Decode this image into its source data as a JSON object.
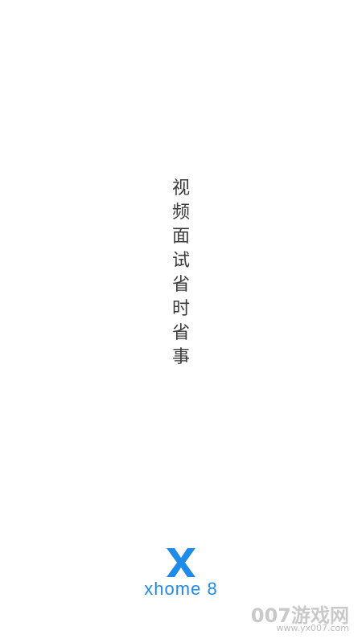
{
  "slogan": {
    "chars_group_1": [
      "视",
      "频",
      "面",
      "试"
    ],
    "chars_group_2": [
      "省",
      "时",
      "省",
      "事"
    ]
  },
  "brand": {
    "name": "xhome 8",
    "logo_icon": "x-logo-icon",
    "color": "#1f8be8"
  },
  "watermark": {
    "title": "007游戏网",
    "url": "www.yx007.com"
  }
}
